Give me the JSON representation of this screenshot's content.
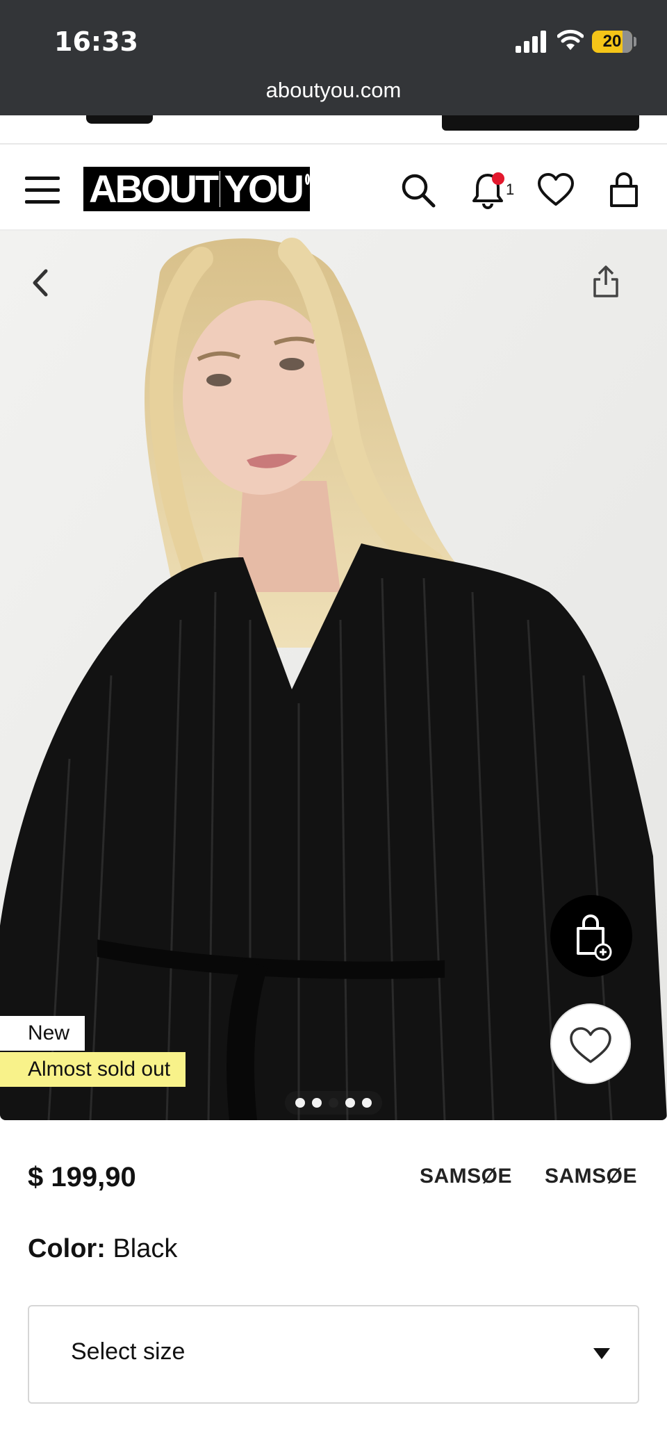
{
  "status_bar": {
    "time": "16:33",
    "battery": "20",
    "url": "aboutyou.com"
  },
  "header": {
    "logo_left": "ABOUT",
    "logo_right": "YOU",
    "notification_count": "1",
    "icons": [
      "menu-icon",
      "search-icon",
      "bell-icon",
      "heart-icon",
      "bag-icon"
    ]
  },
  "hero": {
    "badges": {
      "new": "New",
      "sold_out": "Almost sold out"
    },
    "carousel": {
      "total": 5,
      "active_index": 2
    }
  },
  "product": {
    "price": "$ 199,90",
    "brand_primary": "SAMSØE",
    "brand_secondary": "SAMSØE",
    "color_label": "Color:",
    "color_value": "Black",
    "size_placeholder": "Select size"
  },
  "colors": {
    "status_bar_bg": "#333538",
    "badge_yellow": "#f8f28a",
    "notification_red": "#e3182d",
    "battery_yellow": "#f5c518"
  }
}
